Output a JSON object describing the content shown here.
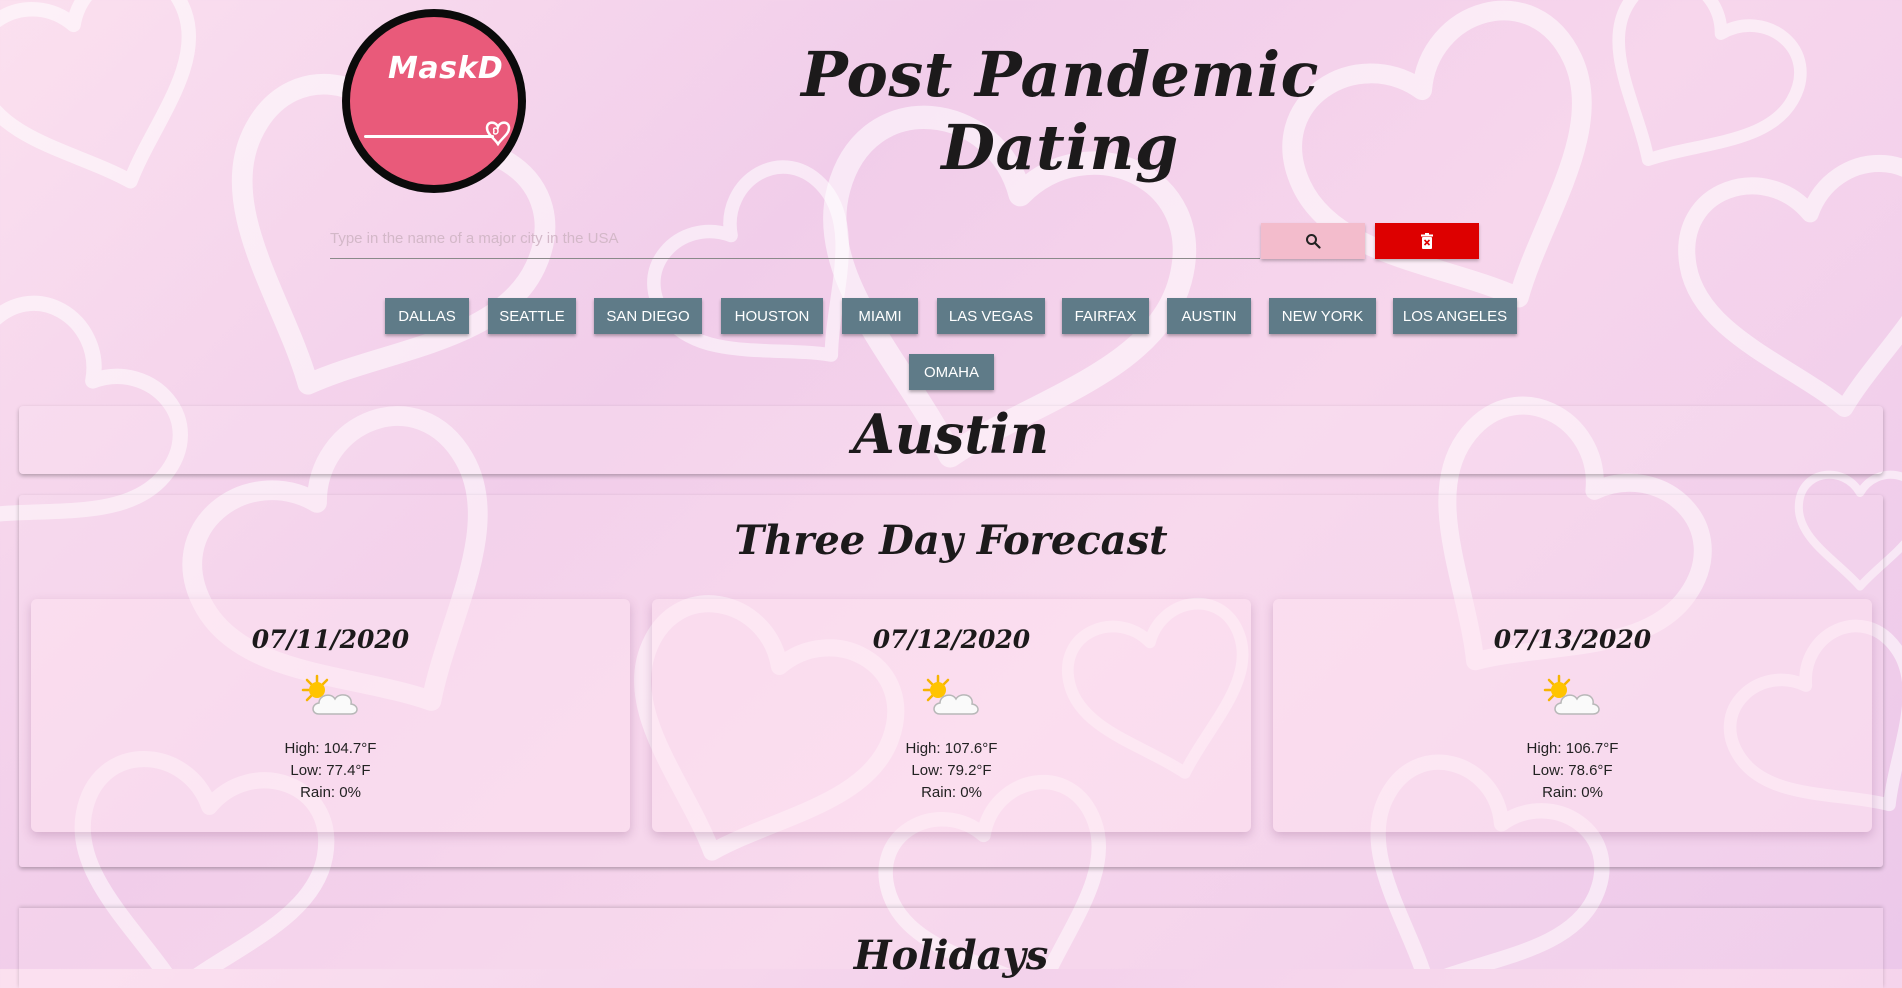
{
  "app": {
    "logo_text": "MaskD",
    "title": "Post Pandemic Dating"
  },
  "search": {
    "placeholder": "Type in the name of a major city in the USA",
    "value": "",
    "search_icon": "search-icon",
    "clear_icon": "trash-icon"
  },
  "cities": [
    "DALLAS",
    "SEATTLE",
    "SAN DIEGO",
    "HOUSTON",
    "MIAMI",
    "LAS VEGAS",
    "FAIRFAX",
    "AUSTIN",
    "NEW YORK",
    "LOS ANGELES",
    "OMAHA"
  ],
  "selected_city": "Austin",
  "forecast": {
    "title": "Three Day Forecast",
    "days": [
      {
        "date": "07/11/2020",
        "icon": "partly-cloudy-icon",
        "high": "High: 104.7°F",
        "low": "Low: 77.4°F",
        "rain": "Rain: 0%"
      },
      {
        "date": "07/12/2020",
        "icon": "partly-cloudy-icon",
        "high": "High: 107.6°F",
        "low": "Low: 79.2°F",
        "rain": "Rain: 0%"
      },
      {
        "date": "07/13/2020",
        "icon": "partly-cloudy-icon",
        "high": "High: 106.7°F",
        "low": "Low: 78.6°F",
        "rain": "Rain: 0%"
      }
    ]
  },
  "holidays": {
    "title": "Holidays"
  },
  "colors": {
    "logo": "#e95a7a",
    "search_button": "#f3bccc",
    "clear_button": "#dd0000",
    "city_button": "#5f7b88"
  }
}
